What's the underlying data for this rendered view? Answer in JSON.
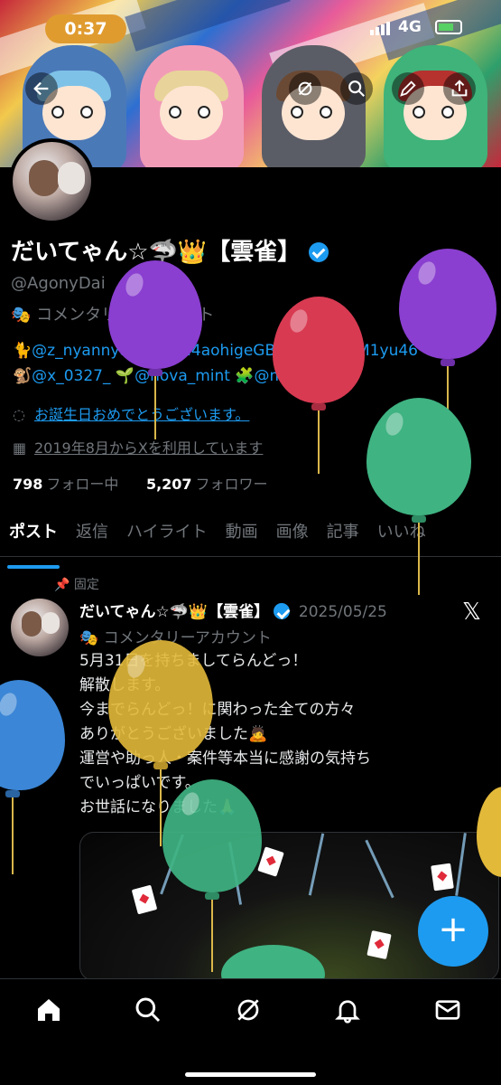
{
  "status_bar": {
    "time": "0:37",
    "network": "4G"
  },
  "header_icons": [
    "back-arrow-icon",
    "grok-icon",
    "search-icon",
    "edit-icon",
    "share-icon"
  ],
  "profile": {
    "name": "だいてゃん☆🦈👑【雲雀】",
    "handle": "@AgonyDai",
    "category": "🎭 コメンタリーアカウント",
    "bio_line1_parts": [
      "🐈",
      "@z_nyannyan",
      "🎴",
      "@M4aohigeGB",
      "🟥",
      "@M1yuM1yu46"
    ],
    "bio_line2_parts": [
      "🐒",
      "@x_0327_",
      "🌱",
      "@nova_mint",
      "🧩",
      "@mck_47"
    ],
    "birthday_text": "お誕生日おめでとうございます。",
    "joined_text": "2019年8月からXを利用しています",
    "following_count": "798",
    "following_label": "フォロー中",
    "followers_count": "5,207",
    "followers_label": "フォロワー"
  },
  "tabs": [
    {
      "label": "ポスト",
      "active": true
    },
    {
      "label": "返信",
      "active": false
    },
    {
      "label": "ハイライト",
      "active": false
    },
    {
      "label": "動画",
      "active": false
    },
    {
      "label": "画像",
      "active": false
    },
    {
      "label": "記事",
      "active": false
    },
    {
      "label": "いいね",
      "active": false
    }
  ],
  "pinned_tweet": {
    "pinned_label": "固定",
    "author_name": "だいてゃん☆🦈👑【雲雀】",
    "date": "2025/05/25",
    "category": "🎭 コメンタリーアカウント",
    "lines": [
      "5月31日を持ちましてらんどっ！",
      "解散します。",
      "今までらんどっ！に関わった全ての方々",
      "ありがとうございました🙇",
      "運営や助っ人・案件等本当に感謝の気持ち",
      "でいっぱいです。",
      "お世話になりました🙏"
    ]
  },
  "fab_label": "+",
  "bottom_nav": [
    "home-icon",
    "search-icon",
    "grok-icon",
    "notifications-icon",
    "messages-icon"
  ],
  "colors": {
    "accent": "#1d9bf0",
    "background": "#000000",
    "secondary_text": "#71767b"
  }
}
